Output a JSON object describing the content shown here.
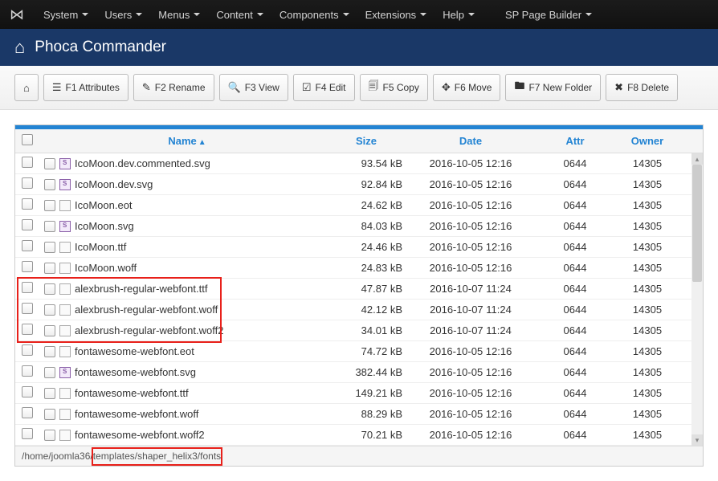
{
  "nav": {
    "items": [
      "System",
      "Users",
      "Menus",
      "Content",
      "Components",
      "Extensions",
      "Help",
      "SP Page Builder"
    ]
  },
  "header": {
    "title": "Phoca Commander"
  },
  "toolbar": {
    "home_icon": "⌂",
    "buttons": [
      {
        "icon": "☰",
        "label": "F1 Attributes"
      },
      {
        "icon": "✎",
        "label": "F2 Rename"
      },
      {
        "icon": "🔍",
        "label": "F3 View"
      },
      {
        "icon": "☑",
        "label": "F4 Edit"
      },
      {
        "icon": "🗐",
        "label": "F5 Copy"
      },
      {
        "icon": "✥",
        "label": "F6 Move"
      },
      {
        "icon": "🖿",
        "label": "F7 New Folder"
      },
      {
        "icon": "✖",
        "label": "F8 Delete"
      }
    ]
  },
  "columns": {
    "name": "Name",
    "size": "Size",
    "date": "Date",
    "attr": "Attr",
    "owner": "Owner"
  },
  "files": [
    {
      "icon": "svg",
      "name": "IcoMoon.dev.commented.svg",
      "size": "93.54 kB",
      "date": "2016-10-05 12:16",
      "attr": "0644",
      "owner": "14305",
      "hl": false
    },
    {
      "icon": "svg",
      "name": "IcoMoon.dev.svg",
      "size": "92.84 kB",
      "date": "2016-10-05 12:16",
      "attr": "0644",
      "owner": "14305",
      "hl": false
    },
    {
      "icon": "gen",
      "name": "IcoMoon.eot",
      "size": "24.62 kB",
      "date": "2016-10-05 12:16",
      "attr": "0644",
      "owner": "14305",
      "hl": false
    },
    {
      "icon": "svg",
      "name": "IcoMoon.svg",
      "size": "84.03 kB",
      "date": "2016-10-05 12:16",
      "attr": "0644",
      "owner": "14305",
      "hl": false
    },
    {
      "icon": "gen",
      "name": "IcoMoon.ttf",
      "size": "24.46 kB",
      "date": "2016-10-05 12:16",
      "attr": "0644",
      "owner": "14305",
      "hl": false
    },
    {
      "icon": "gen",
      "name": "IcoMoon.woff",
      "size": "24.83 kB",
      "date": "2016-10-05 12:16",
      "attr": "0644",
      "owner": "14305",
      "hl": false
    },
    {
      "icon": "gen",
      "name": "alexbrush-regular-webfont.ttf",
      "size": "47.87 kB",
      "date": "2016-10-07 11:24",
      "attr": "0644",
      "owner": "14305",
      "hl": true
    },
    {
      "icon": "gen",
      "name": "alexbrush-regular-webfont.woff",
      "size": "42.12 kB",
      "date": "2016-10-07 11:24",
      "attr": "0644",
      "owner": "14305",
      "hl": true
    },
    {
      "icon": "gen",
      "name": "alexbrush-regular-webfont.woff2",
      "size": "34.01 kB",
      "date": "2016-10-07 11:24",
      "attr": "0644",
      "owner": "14305",
      "hl": true
    },
    {
      "icon": "gen",
      "name": "fontawesome-webfont.eot",
      "size": "74.72 kB",
      "date": "2016-10-05 12:16",
      "attr": "0644",
      "owner": "14305",
      "hl": false
    },
    {
      "icon": "svg",
      "name": "fontawesome-webfont.svg",
      "size": "382.44 kB",
      "date": "2016-10-05 12:16",
      "attr": "0644",
      "owner": "14305",
      "hl": false
    },
    {
      "icon": "gen",
      "name": "fontawesome-webfont.ttf",
      "size": "149.21 kB",
      "date": "2016-10-05 12:16",
      "attr": "0644",
      "owner": "14305",
      "hl": false
    },
    {
      "icon": "gen",
      "name": "fontawesome-webfont.woff",
      "size": "88.29 kB",
      "date": "2016-10-05 12:16",
      "attr": "0644",
      "owner": "14305",
      "hl": false
    },
    {
      "icon": "gen",
      "name": "fontawesome-webfont.woff2",
      "size": "70.21 kB",
      "date": "2016-10-05 12:16",
      "attr": "0644",
      "owner": "14305",
      "hl": false
    }
  ],
  "path": {
    "prefix": "/home/joomla36/",
    "highlight": "templates/shaper_helix3/fonts"
  }
}
